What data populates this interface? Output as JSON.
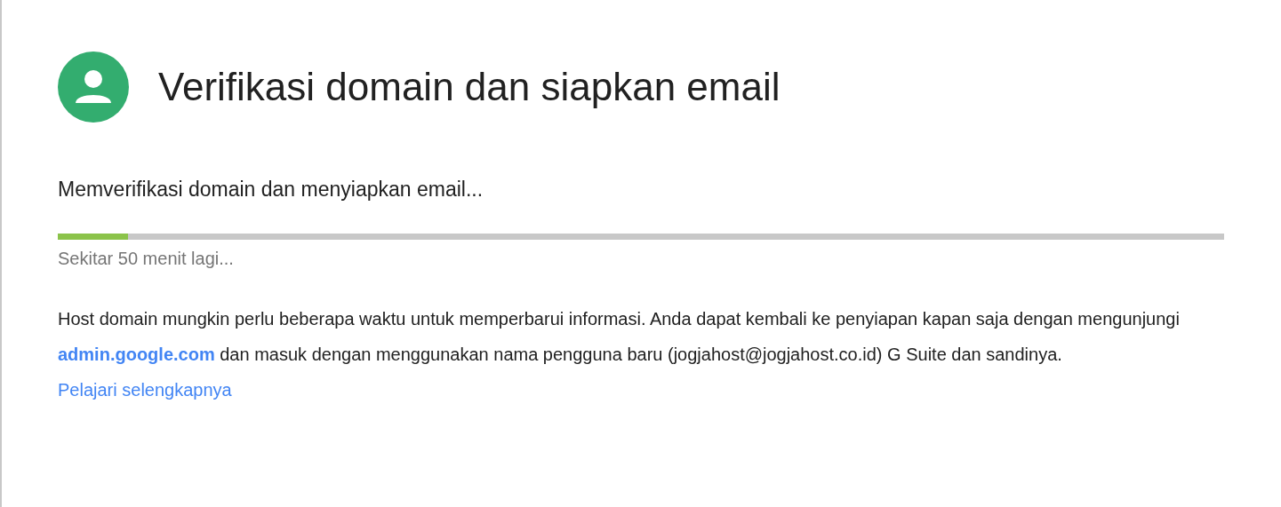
{
  "header": {
    "title": "Verifikasi domain dan siapkan email"
  },
  "status": {
    "heading": "Memverifikasi domain dan menyiapkan email...",
    "level": 0.06,
    "estimate": "Sekitar 50 menit lagi..."
  },
  "info": {
    "text_before": "Host domain mungkin perlu beberapa waktu untuk memperbarui informasi. Anda dapat kembali ke penyiapan kapan saja dengan mengunjungi",
    "admin_link": "admin.google.com",
    "text_after": "dan masuk dengan menggunakan nama pengguna baru (jogjahost@jogjahost.co.id) G Suite dan sandinya.",
    "learn_more_link": "Pelajari selengkapnya"
  }
}
